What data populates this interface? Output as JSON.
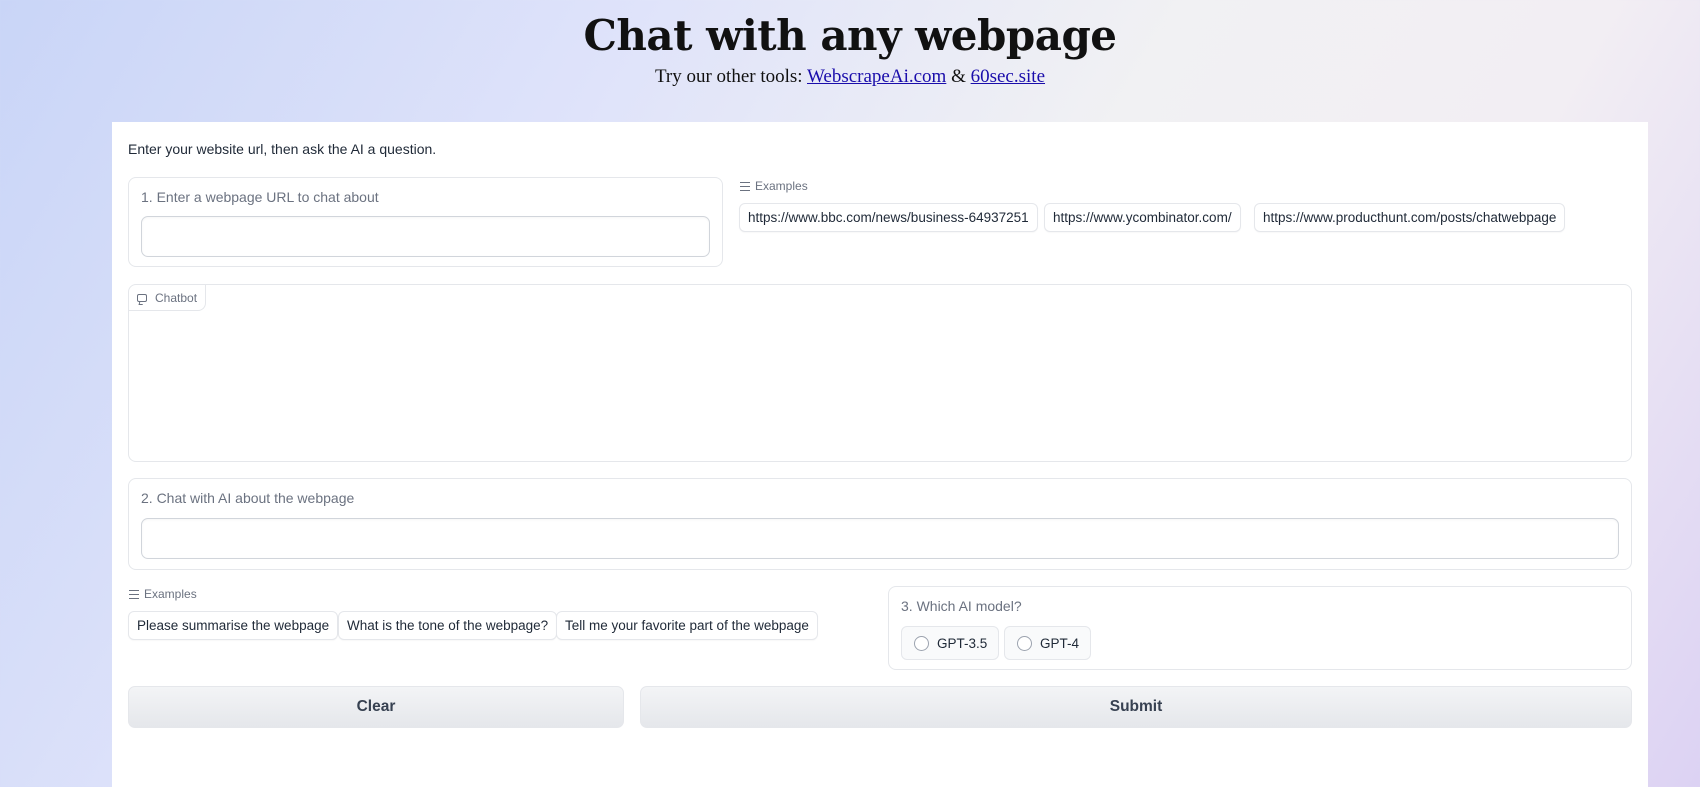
{
  "header": {
    "title": "Chat with any webpage",
    "subtitle_prefix": "Try our other tools: ",
    "link1": "WebscrapeAi.com",
    "separator": " & ",
    "link2": "60sec.site"
  },
  "intro": "Enter your website url, then ask the AI a question.",
  "url_input": {
    "label": "1. Enter a webpage URL to chat about",
    "value": ""
  },
  "url_examples": {
    "heading": "Examples",
    "items": [
      "https://www.bbc.com/news/business-64937251",
      "https://www.ycombinator.com/",
      "https://www.producthunt.com/posts/chatwebpage"
    ]
  },
  "chatbot": {
    "label": "Chatbot"
  },
  "chat_input": {
    "label": "2. Chat with AI about the webpage",
    "value": ""
  },
  "question_examples": {
    "heading": "Examples",
    "items": [
      "Please summarise the webpage",
      "What is the tone of the webpage?",
      "Tell me your favorite part of the webpage"
    ]
  },
  "model": {
    "label": "3. Which AI model?",
    "options": [
      "GPT-3.5",
      "GPT-4"
    ]
  },
  "buttons": {
    "clear": "Clear",
    "submit": "Submit"
  },
  "colors": {
    "link": "#1a0dab",
    "border": "#e5e7eb",
    "button_bg": "#f3f4f6"
  }
}
